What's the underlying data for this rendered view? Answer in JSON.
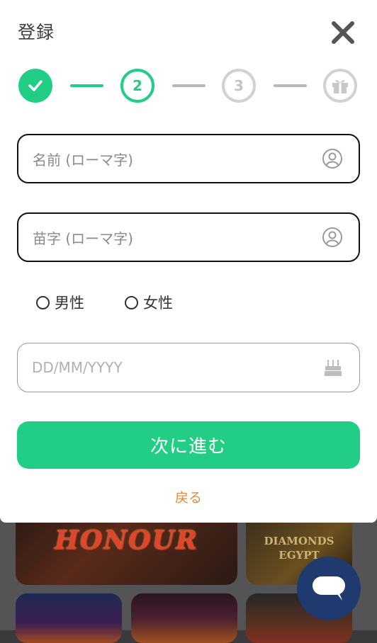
{
  "modal": {
    "title": "登録",
    "close_icon": "close-icon",
    "steps": [
      {
        "state": "done",
        "icon": "check-icon"
      },
      {
        "state": "current",
        "label": "2"
      },
      {
        "state": "pending",
        "label": "3"
      },
      {
        "state": "pending",
        "icon": "gift-icon"
      }
    ],
    "fields": {
      "first_name": {
        "placeholder": "名前 (ローマ字)",
        "icon": "user-icon"
      },
      "last_name": {
        "placeholder": "苗字 (ローマ字)",
        "icon": "user-icon"
      },
      "birthdate": {
        "placeholder": "DD/MM/YYYY",
        "icon": "birthday-cake-icon"
      }
    },
    "gender": {
      "options": [
        "男性",
        "女性"
      ]
    },
    "submit_label": "次に進む",
    "back_label": "戻る"
  },
  "background": {
    "games": [
      {
        "title": "HONOUR"
      },
      {
        "title": "DIAMONDS EGYPT"
      }
    ]
  },
  "colors": {
    "accent": "#22ce85",
    "link": "#e08a3a",
    "chat": "#1e3a6e"
  },
  "chat_icon": "chat-bubble-icon"
}
